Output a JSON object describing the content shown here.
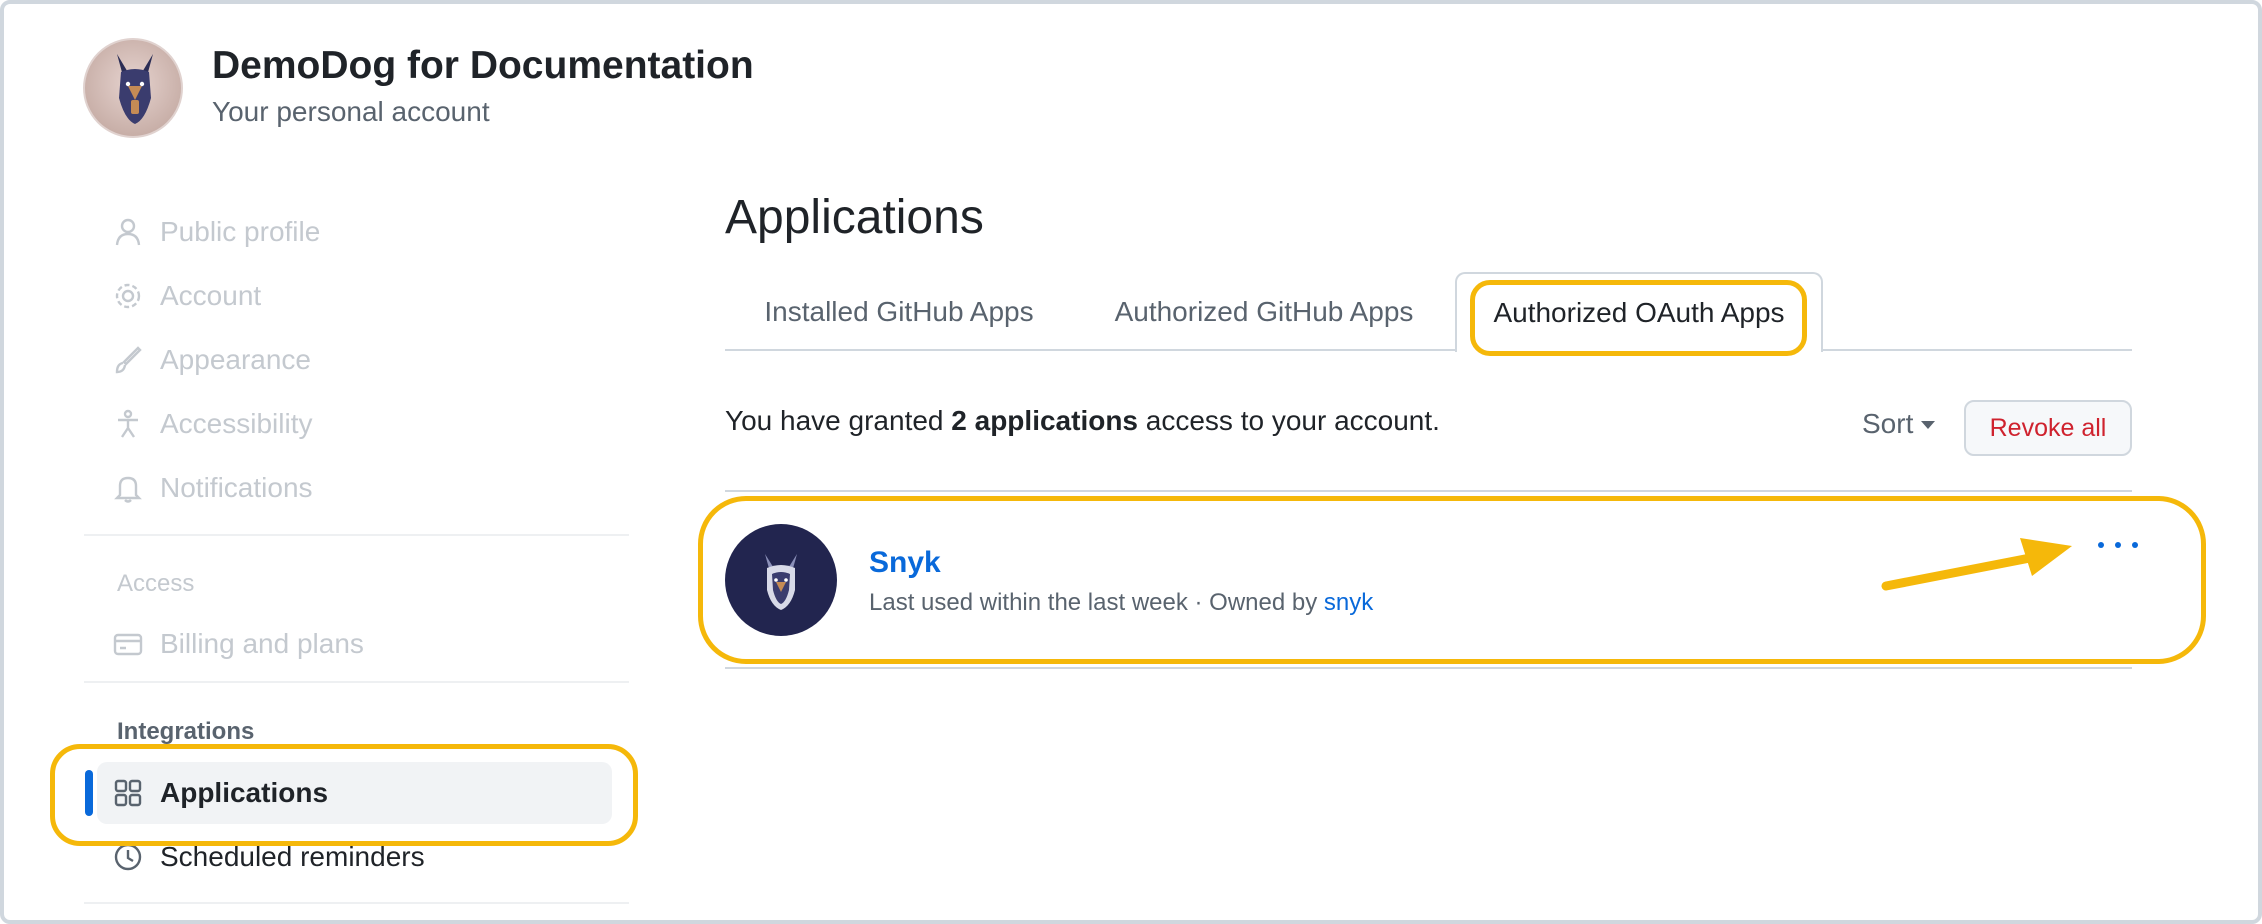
{
  "account": {
    "name": "DemoDog for Documentation",
    "subtitle": "Your personal account"
  },
  "sidebar": {
    "items": [
      {
        "label": "Public profile",
        "icon": "person-icon"
      },
      {
        "label": "Account",
        "icon": "gear-icon"
      },
      {
        "label": "Appearance",
        "icon": "paintbrush-icon"
      },
      {
        "label": "Accessibility",
        "icon": "accessibility-icon"
      },
      {
        "label": "Notifications",
        "icon": "bell-icon"
      }
    ],
    "access_header": "Access",
    "billing_label": "Billing and plans",
    "integrations_header": "Integrations",
    "applications_label": "Applications",
    "reminders_label": "Scheduled reminders"
  },
  "main": {
    "title": "Applications",
    "tabs": [
      {
        "label": "Installed GitHub Apps",
        "selected": false
      },
      {
        "label": "Authorized GitHub Apps",
        "selected": false
      },
      {
        "label": "Authorized OAuth Apps",
        "selected": true
      }
    ],
    "granted_prefix": "You have granted",
    "granted_count": "2 applications",
    "granted_suffix": "access to your account.",
    "sort_label": "Sort",
    "revoke_label": "Revoke all",
    "apps": [
      {
        "name": "Snyk",
        "meta_prefix": "Last used within the last week · Owned by",
        "owner": "snyk"
      }
    ]
  },
  "colors": {
    "accent": "#0969da",
    "danger": "#cf222e",
    "highlight": "#f5b80a"
  }
}
